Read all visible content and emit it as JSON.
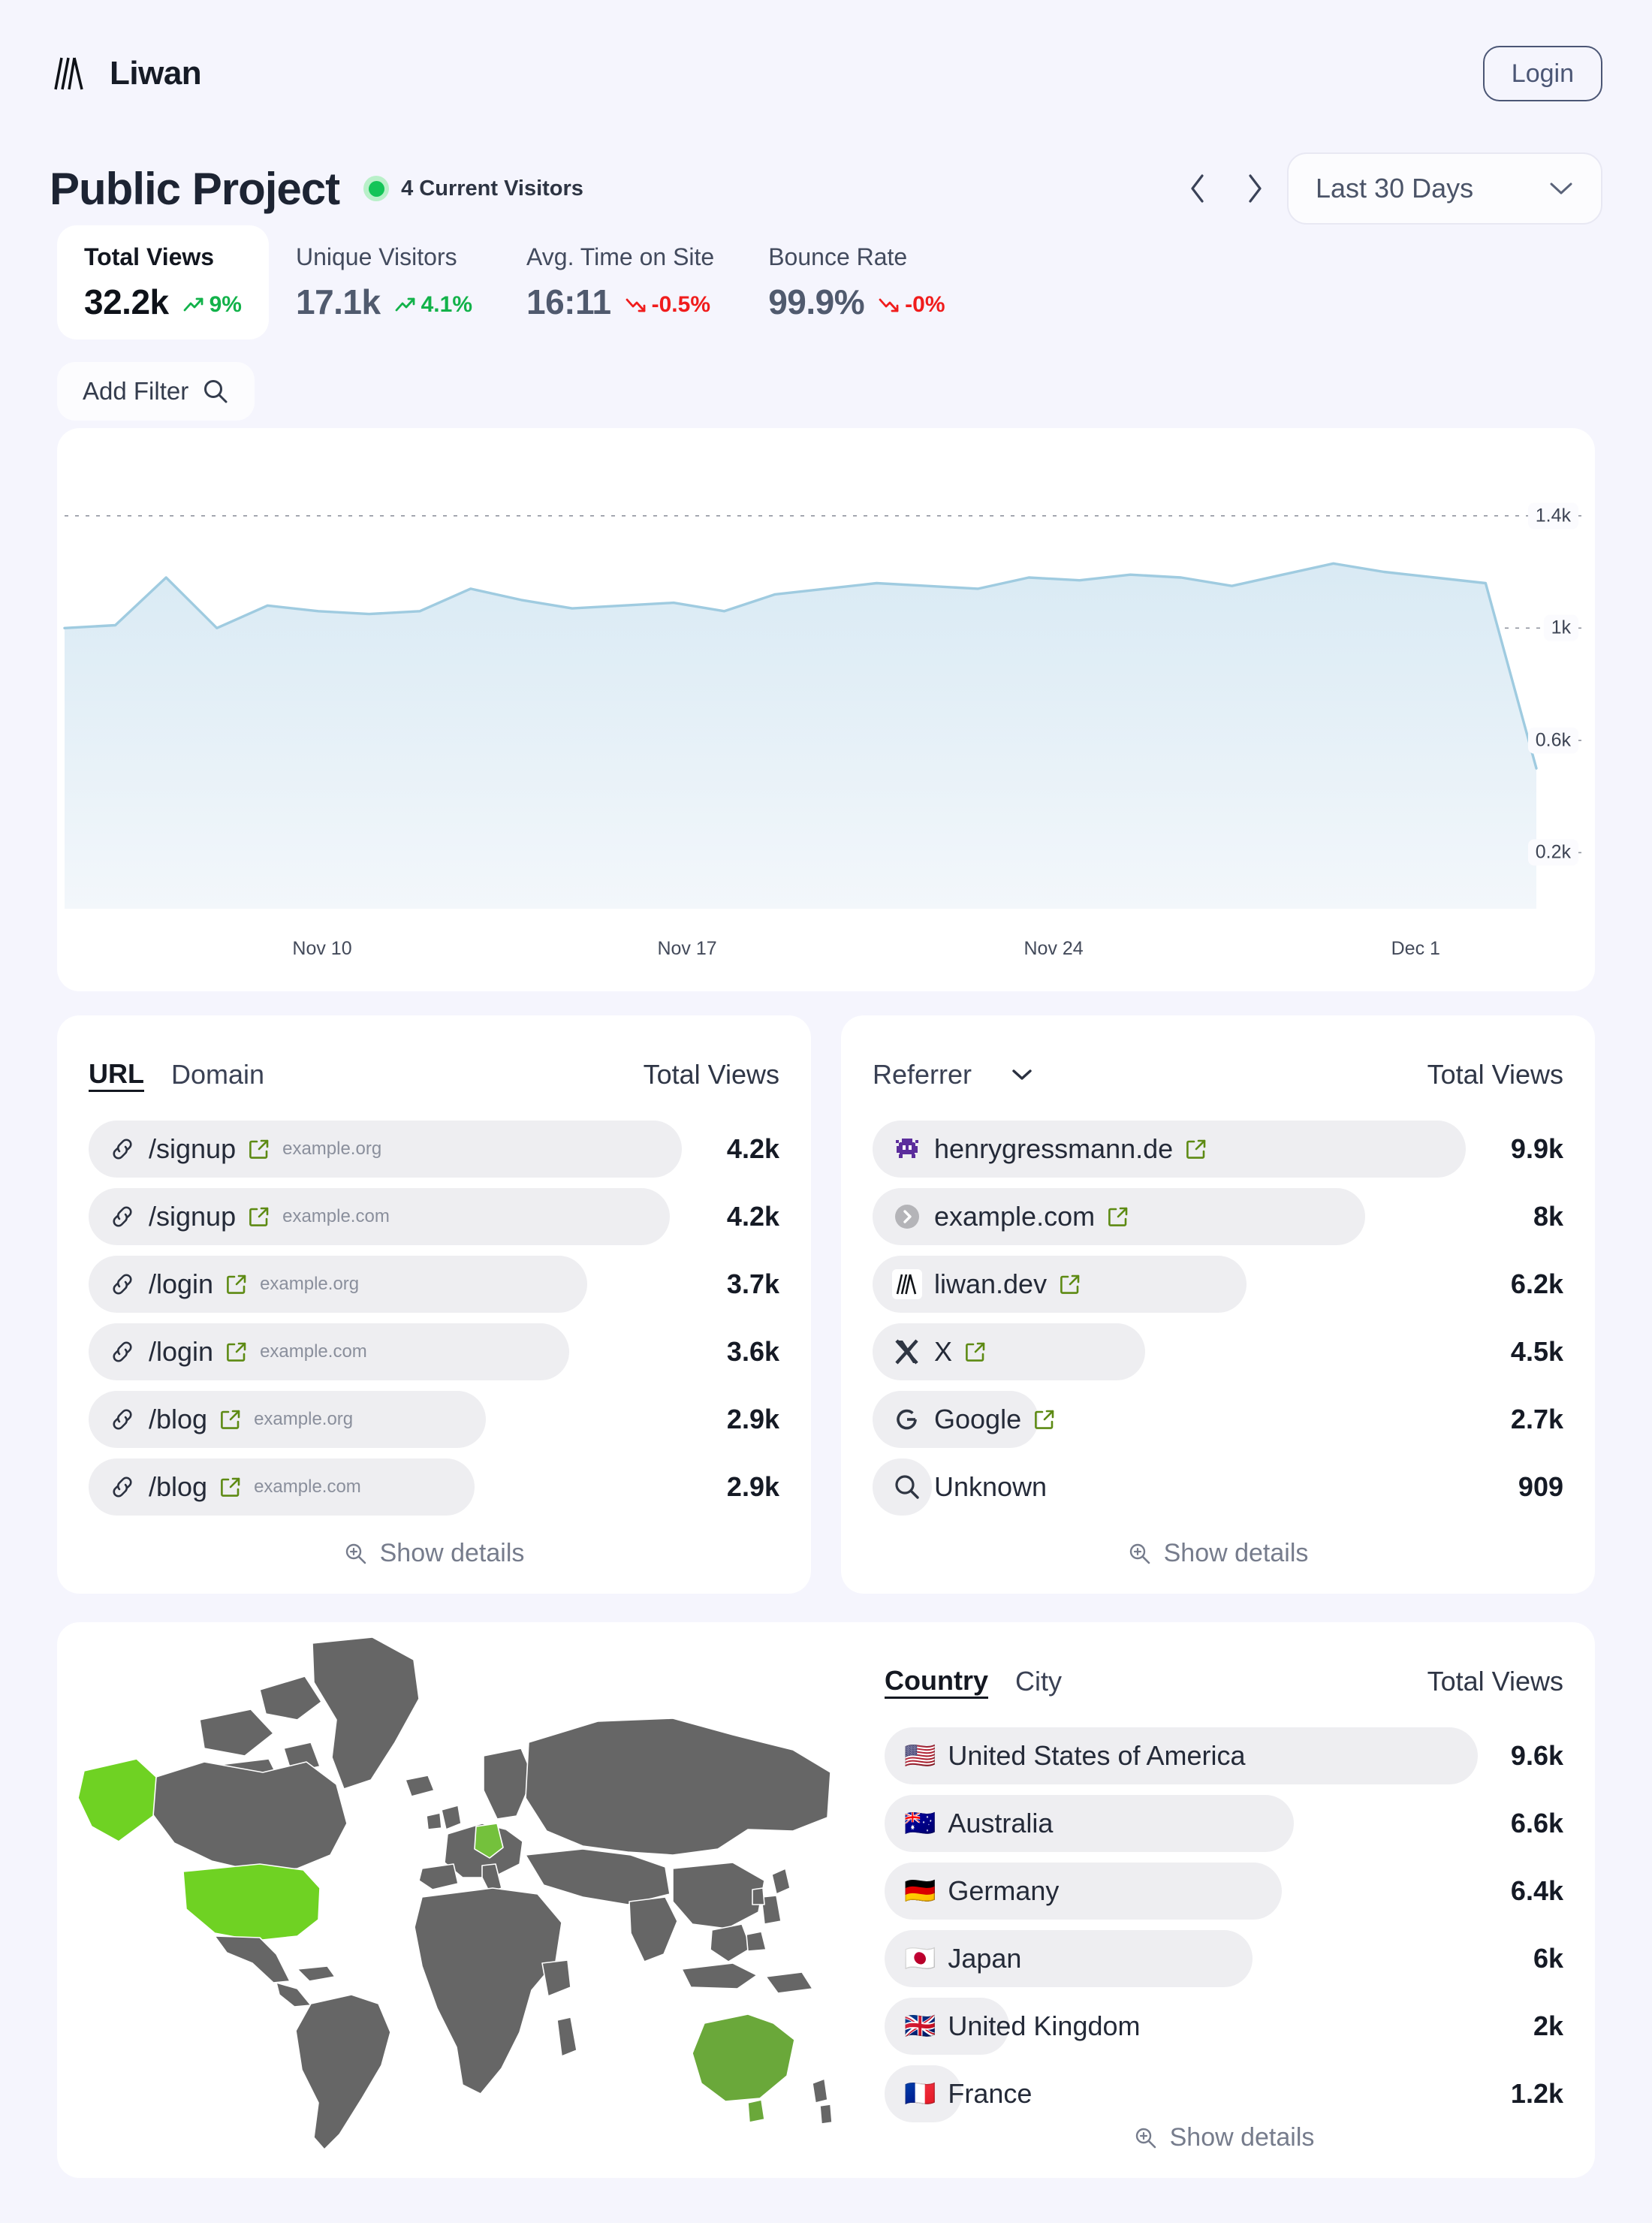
{
  "brand": {
    "name": "Liwan",
    "logo_icon": "liwan-logo-icon"
  },
  "header": {
    "login_label": "Login"
  },
  "project": {
    "title": "Public Project",
    "current_visitors": "4 Current Visitors",
    "status_color": "#14c458"
  },
  "range": {
    "value": "Last 30 Days",
    "prev_icon": "chevron-left-icon",
    "next_icon": "chevron-right-icon",
    "chevron_icon": "chevron-down-icon"
  },
  "metrics": [
    {
      "label": "Total Views",
      "value": "32.2k",
      "delta": "9%",
      "trend": "up",
      "selected": true
    },
    {
      "label": "Unique Visitors",
      "value": "17.1k",
      "delta": "4.1%",
      "trend": "up",
      "selected": false
    },
    {
      "label": "Avg. Time on Site",
      "value": "16:11",
      "delta": "-0.5%",
      "trend": "down",
      "selected": false
    },
    {
      "label": "Bounce Rate",
      "value": "99.9%",
      "delta": "-0%",
      "trend": "down",
      "selected": false
    }
  ],
  "filter": {
    "label": "Add Filter",
    "icon": "search-icon"
  },
  "chart_data": {
    "type": "area",
    "title": "",
    "xlabel": "",
    "ylabel": "",
    "ytick_labels": [
      "1.4k",
      "1k",
      "0.6k",
      "0.2k"
    ],
    "yticks": [
      1400,
      1000,
      600,
      200
    ],
    "ylim": [
      0,
      1600
    ],
    "xtick_labels": [
      "Nov 10",
      "Nov 17",
      "Nov 24",
      "Dec 1"
    ],
    "xtick_positions": [
      0.175,
      0.423,
      0.672,
      0.918
    ],
    "grid": true,
    "line_color": "#9fcbe0",
    "fill_top_color": "#d9eaf4",
    "fill_bottom_color": "#f3f7fb",
    "series": [
      {
        "name": "Total Views",
        "values": [
          1000,
          1010,
          1180,
          1000,
          1080,
          1060,
          1050,
          1060,
          1140,
          1100,
          1070,
          1080,
          1090,
          1060,
          1120,
          1140,
          1160,
          1150,
          1140,
          1180,
          1170,
          1190,
          1180,
          1150,
          1190,
          1230,
          1200,
          1180,
          1160,
          500
        ]
      }
    ]
  },
  "url_panel": {
    "tabs": [
      {
        "label": "URL",
        "selected": true
      },
      {
        "label": "Domain",
        "selected": false
      }
    ],
    "value_header": "Total Views",
    "rows": [
      {
        "icon": "link-icon",
        "name": "/signup",
        "external_icon": "external-link-icon",
        "sub": "example.org",
        "value": "4.2k",
        "bar_pct": 100
      },
      {
        "icon": "link-icon",
        "name": "/signup",
        "external_icon": "external-link-icon",
        "sub": "example.com",
        "value": "4.2k",
        "bar_pct": 98
      },
      {
        "icon": "link-icon",
        "name": "/login",
        "external_icon": "external-link-icon",
        "sub": "example.org",
        "value": "3.7k",
        "bar_pct": 84
      },
      {
        "icon": "link-icon",
        "name": "/login",
        "external_icon": "external-link-icon",
        "sub": "example.com",
        "value": "3.6k",
        "bar_pct": 81
      },
      {
        "icon": "link-icon",
        "name": "/blog",
        "external_icon": "external-link-icon",
        "sub": "example.org",
        "value": "2.9k",
        "bar_pct": 67
      },
      {
        "icon": "link-icon",
        "name": "/blog",
        "external_icon": "external-link-icon",
        "sub": "example.com",
        "value": "2.9k",
        "bar_pct": 65
      }
    ],
    "show_details": {
      "label": "Show details",
      "icon": "zoom-in-icon"
    }
  },
  "referrer_panel": {
    "tabs": [
      {
        "label": "Referrer",
        "selected": false
      }
    ],
    "dropdown_icon": "chevron-down-icon",
    "value_header": "Total Views",
    "rows": [
      {
        "icon": "space-invader-icon",
        "name": "henrygressmann.de",
        "external_icon": "external-link-icon",
        "value": "9.9k",
        "bar_pct": 100
      },
      {
        "icon": "chevron-circle-icon",
        "name": "example.com",
        "external_icon": "external-link-icon",
        "value": "8k",
        "bar_pct": 83
      },
      {
        "icon": "liwan-logo-icon",
        "name": "liwan.dev",
        "external_icon": "external-link-icon",
        "value": "6.2k",
        "bar_pct": 63
      },
      {
        "icon": "x-logo-icon",
        "name": "X",
        "external_icon": "external-link-icon",
        "value": "4.5k",
        "bar_pct": 46
      },
      {
        "icon": "google-logo-icon",
        "name": "Google",
        "external_icon": "external-link-icon",
        "value": "2.7k",
        "bar_pct": 28
      },
      {
        "icon": "search-icon",
        "name": "Unknown",
        "external_icon": "",
        "value": "909",
        "bar_pct": 10
      }
    ],
    "show_details": {
      "label": "Show details",
      "icon": "zoom-in-icon"
    }
  },
  "geo_panel": {
    "tabs": [
      {
        "label": "Country",
        "selected": true
      },
      {
        "label": "City",
        "selected": false
      }
    ],
    "value_header": "Total Views",
    "rows": [
      {
        "flag": "🇺🇸",
        "name": "United States of America",
        "value": "9.6k",
        "bar_pct": 100
      },
      {
        "flag": "🇦🇺",
        "name": "Australia",
        "value": "6.6k",
        "bar_pct": 69
      },
      {
        "flag": "🇩🇪",
        "name": "Germany",
        "value": "6.4k",
        "bar_pct": 67
      },
      {
        "flag": "🇯🇵",
        "name": "Japan",
        "value": "6k",
        "bar_pct": 62
      },
      {
        "flag": "🇬🇧",
        "name": "United Kingdom",
        "value": "2k",
        "bar_pct": 21
      },
      {
        "flag": "🇫🇷",
        "name": "France",
        "value": "1.2k",
        "bar_pct": 13
      }
    ],
    "show_details": {
      "label": "Show details",
      "icon": "zoom-in-icon"
    }
  },
  "map": {
    "land_color": "#666666",
    "highlight_colors": {
      "usa": "#6fd223",
      "australia": "#6aa83a",
      "germany": "#74c13c"
    }
  }
}
